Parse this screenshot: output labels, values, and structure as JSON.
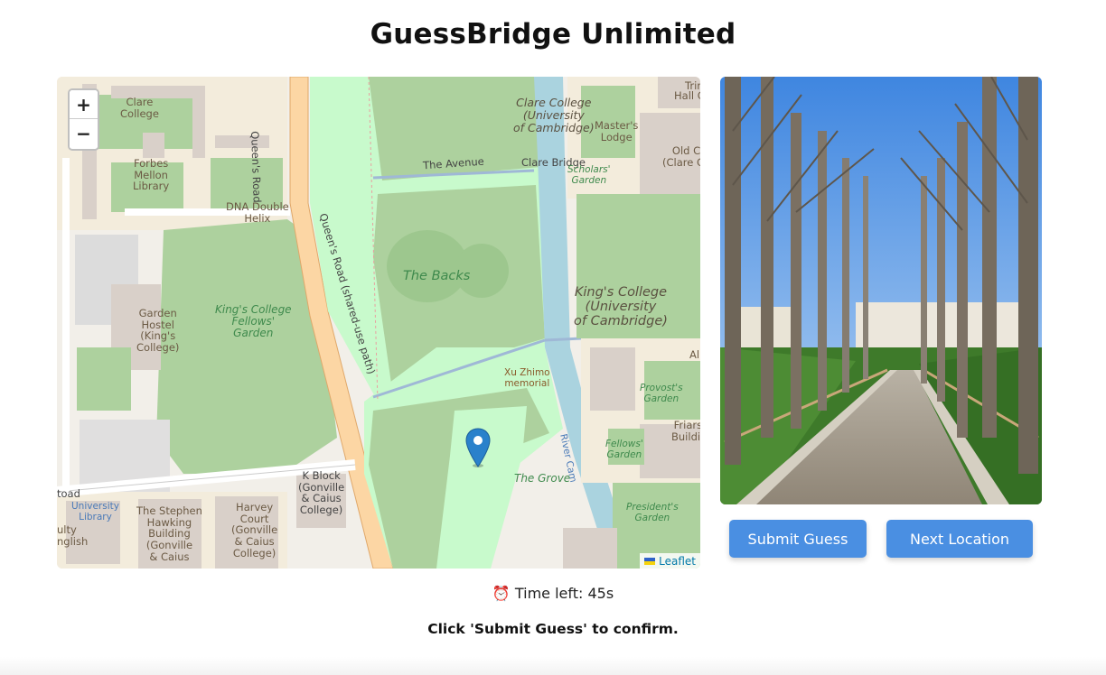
{
  "app": {
    "title": "GuessBridge Unlimited"
  },
  "map": {
    "zoom_in": "+",
    "zoom_out": "−",
    "attribution": "Leaflet",
    "labels": {
      "clare_college": "Clare\nCollege",
      "clare_college_uni": "Clare College\n(University\nof Cambridge)",
      "masters_lodge": "Master's\nLodge",
      "old_court": "Old C\n(Clare Co",
      "hall_court": "Hall C",
      "trinity": "Trin",
      "forbes": "Forbes\nMellon\nLibrary",
      "dna_helix": "DNA Double\nHelix",
      "the_avenue": "The Avenue",
      "clare_bridge": "Clare Bridge",
      "scholars_garden": "Scholars'\nGarden",
      "queens_road": "Queen's Road",
      "queens_road_shared": "Queen's Road (shared-use path)",
      "the_backs": "The Backs",
      "kings_college": "King's College\n(University\nof Cambridge)",
      "garden_hostel": "Garden\nHostel\n(King's\nCollege)",
      "kings_fellows_garden": "King's College\nFellows'\nGarden",
      "xu_zhimo": "Xu Zhimo\nmemorial",
      "provosts_garden": "Provost's\nGarden",
      "friars": "Friars\nBuildir",
      "fellows_garden": "Fellows'\nGarden",
      "river_cam": "River Cam",
      "the_grove": "The Grove",
      "k_block": "K Block\n(Gonville\n& Caius\nCollege)",
      "harvey_court": "Harvey\nCourt\n(Gonville\n& Caius\nCollege)",
      "stephen_hawking": "The Stephen\nHawking\nBuilding\n(Gonville\n& Caius",
      "university_library": "University\nLibrary",
      "presidents_garden": "President's\nGarden",
      "road_left": "toad",
      "faculty_english": "ulty\nnglish",
      "alt": "Al"
    }
  },
  "buttons": {
    "submit": "Submit Guess",
    "next": "Next Location"
  },
  "status": {
    "timer_icon": "⏰",
    "timer_text": "Time left: 45s",
    "hint": "Click 'Submit Guess' to confirm."
  },
  "colors": {
    "button": "#4a8fe2",
    "marker": "#2a81cb",
    "park": "#c8facc",
    "grass": "#add19e",
    "river": "#aad3df",
    "road_major": "#fcd6a4",
    "building": "#d9d0c9"
  }
}
